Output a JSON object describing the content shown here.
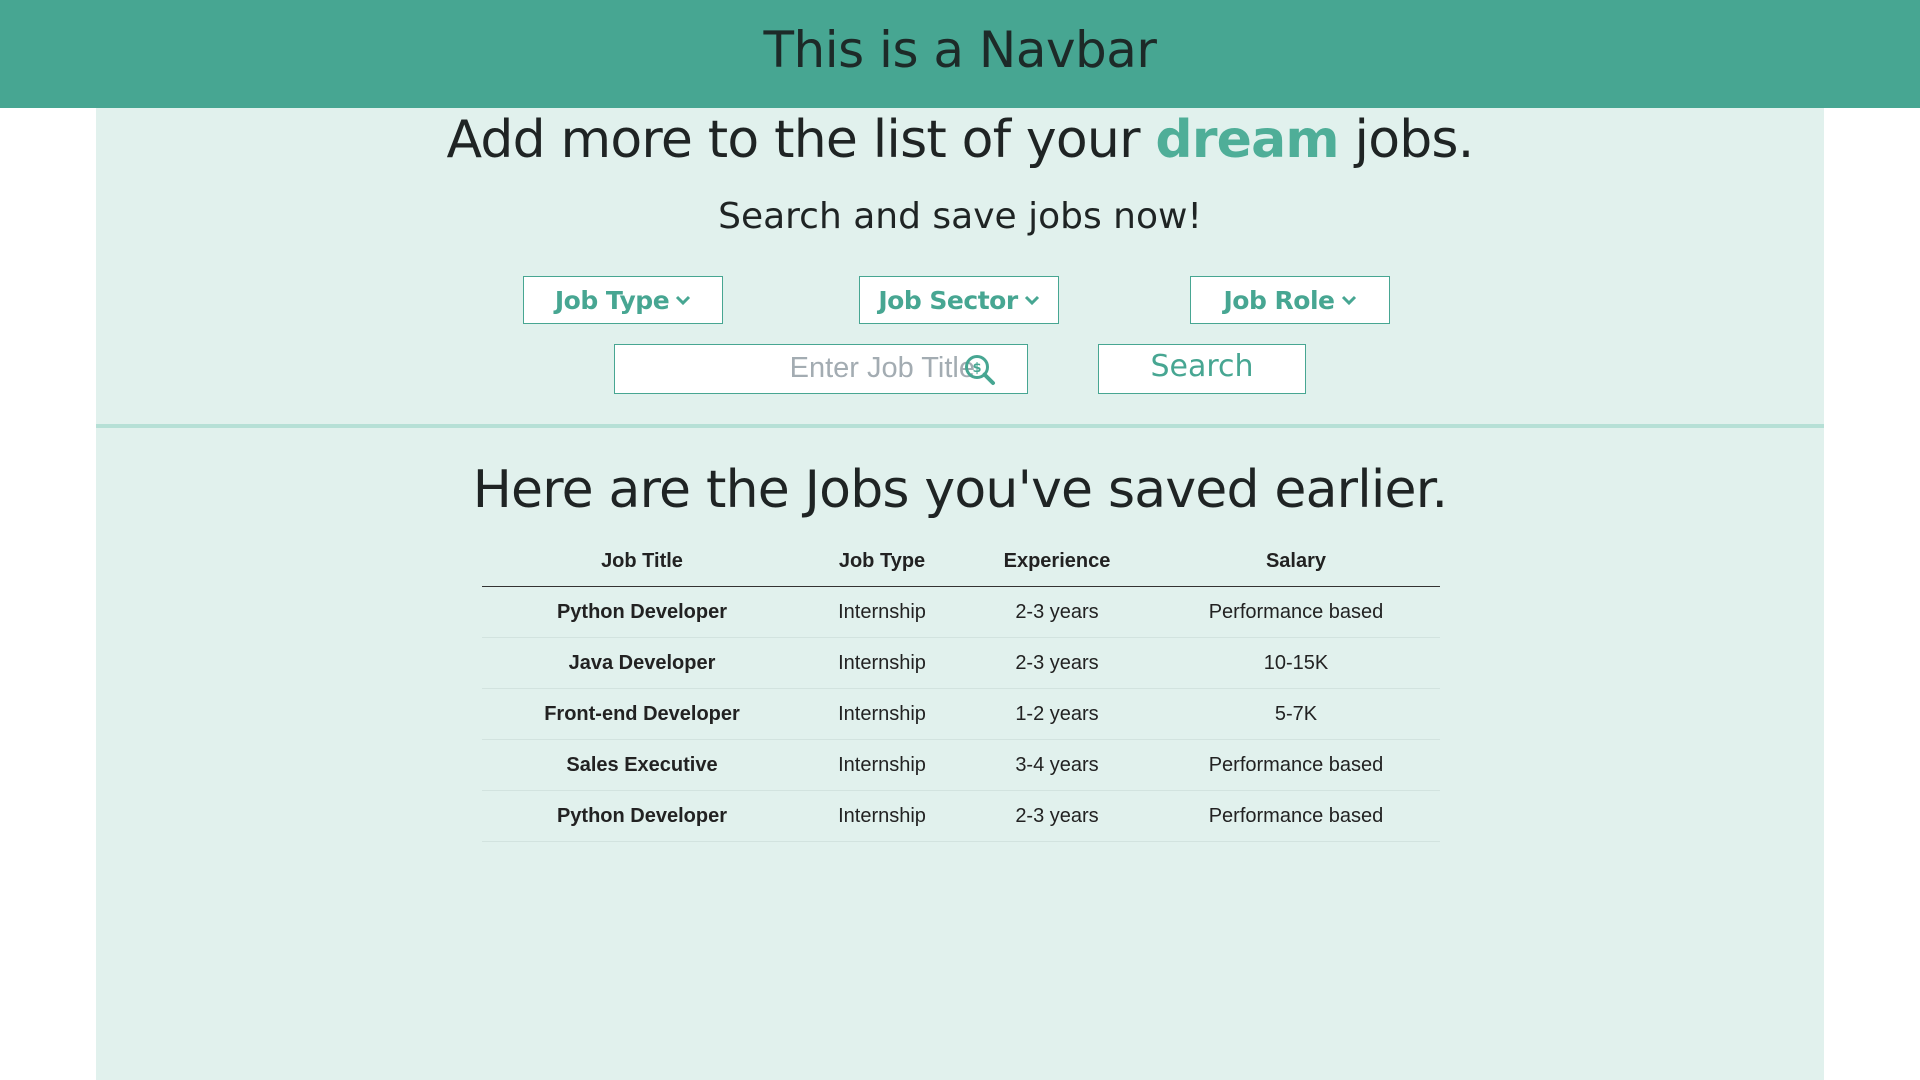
{
  "navbar": {
    "title": "This is a Navbar"
  },
  "hero": {
    "title_before": "Add more to the list of your ",
    "title_accent": "dream",
    "title_after": " jobs.",
    "subtitle": "Search and save jobs now!"
  },
  "filters": {
    "job_type": {
      "label": "Job Type",
      "icon": "chevron-down-icon"
    },
    "job_sector": {
      "label": "Job Sector",
      "icon": "chevron-down-icon"
    },
    "job_role": {
      "label": "Job Role",
      "icon": "chevron-down-icon"
    }
  },
  "search": {
    "placeholder": "Enter Job Title",
    "value": "",
    "icon": "dollar-search-icon",
    "button_label": "Search"
  },
  "saved": {
    "title": "Here are the Jobs you've saved earlier.",
    "columns": [
      "Job Title",
      "Job Type",
      "Experience",
      "Salary"
    ],
    "rows": [
      [
        "Python Developer",
        "Internship",
        "2-3 years",
        "Performance based"
      ],
      [
        "Java Developer",
        "Internship",
        "2-3 years",
        "10-15K"
      ],
      [
        "Front-end Developer",
        "Internship",
        "1-2 years",
        "5-7K"
      ],
      [
        "Sales Executive",
        "Internship",
        "3-4 years",
        "Performance based"
      ],
      [
        "Python Developer",
        "Internship",
        "2-3 years",
        "Performance based"
      ]
    ]
  },
  "colors": {
    "navbar": "#47a692",
    "accent": "#4fae98",
    "panel_background": "#e1f1ed",
    "divider": "#b6e0d6"
  }
}
